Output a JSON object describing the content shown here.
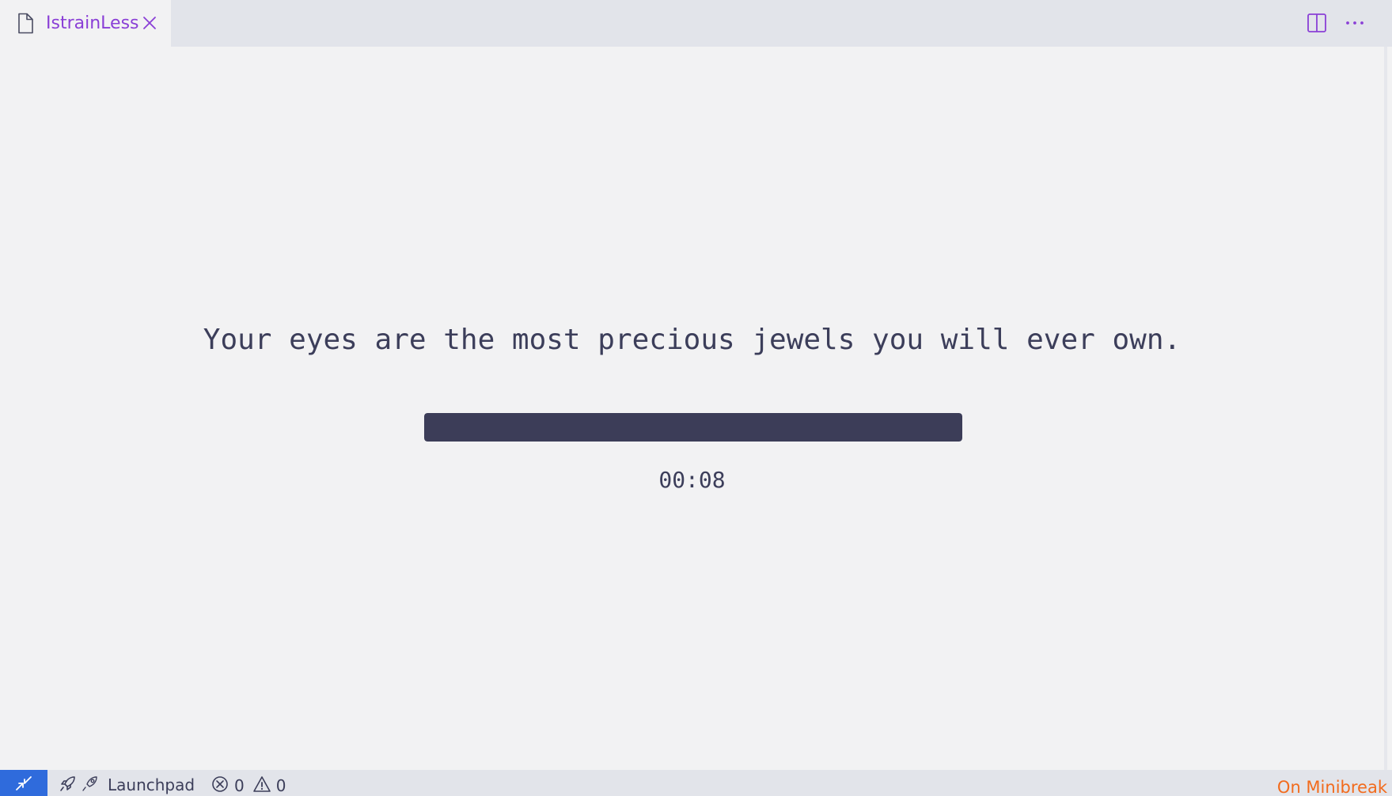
{
  "tab": {
    "label": "IstrainLess",
    "icon": "file-icon",
    "close_icon": "close-icon"
  },
  "editor_actions": {
    "split_icon": "split-editor-icon",
    "more_icon": "more-actions-icon"
  },
  "main": {
    "quote": "Your eyes are the most precious jewels you will ever own.",
    "progress": 1.0,
    "timer": "00:08"
  },
  "statusbar": {
    "remote_icon": "remote-icon",
    "launchpad_label": "Launchpad",
    "errors": "0",
    "warnings": "0",
    "break_status": "On Minibreak"
  },
  "colors": {
    "accent_tab": "#8a3fd6",
    "progress_fill": "#3c3d58",
    "remote_button": "#2f6bdc",
    "break_status": "#f26b1d"
  }
}
